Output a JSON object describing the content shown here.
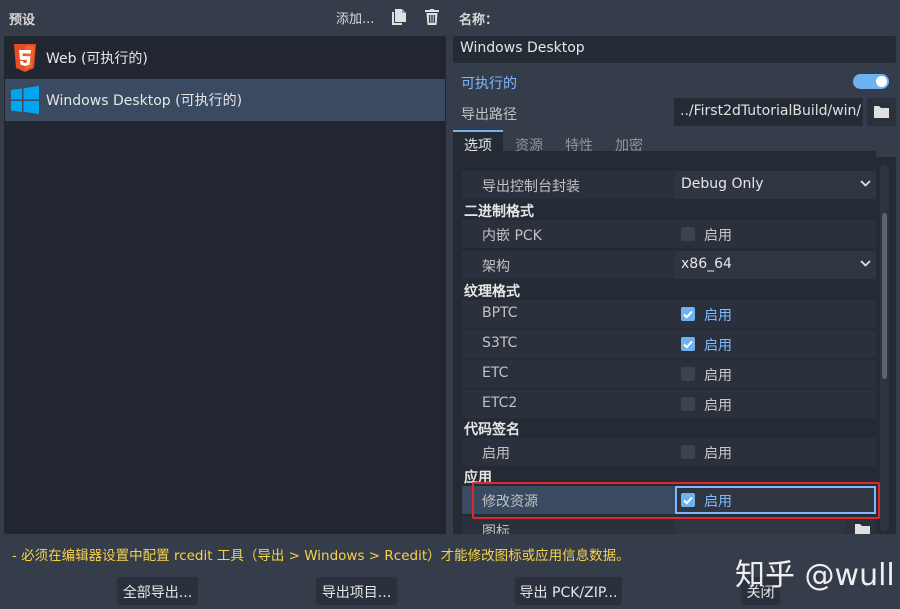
{
  "left": {
    "presets_label": "预设",
    "add_label": "添加...",
    "presets": [
      {
        "label": "Web (可执行的)",
        "icon": "html5-icon",
        "selected": false
      },
      {
        "label": "Windows Desktop (可执行的)",
        "icon": "windows-icon",
        "selected": true
      }
    ]
  },
  "right": {
    "name_label": "名称：",
    "name_value": "Windows Desktop",
    "runnable_label": "可执行的",
    "runnable_on": true,
    "export_path_label": "导出路径",
    "export_path_value": "../First2dTutorialBuild/win/",
    "tabs": [
      "选项",
      "资源",
      "特性",
      "加密"
    ],
    "active_tab": 0,
    "options": {
      "export_console_wrapper_label": "导出控制台封装",
      "export_console_wrapper_value": "Debug Only",
      "binary_format_category": "二进制格式",
      "embed_pck_label": "内嵌 PCK",
      "embed_pck_value": "启用",
      "arch_label": "架构",
      "arch_value": "x86_64",
      "texture_format_category": "纹理格式",
      "bptc_label": "BPTC",
      "bptc_value": "启用",
      "s3tc_label": "S3TC",
      "s3tc_value": "启用",
      "etc_label": "ETC",
      "etc_value": "启用",
      "etc2_label": "ETC2",
      "etc2_value": "启用",
      "codesign_category": "代码签名",
      "codesign_enable_label": "启用",
      "codesign_enable_value": "启用",
      "application_category": "应用",
      "modify_resources_label": "修改资源",
      "modify_resources_value": "启用",
      "icon_label": "图标"
    }
  },
  "warning": "- 必须在编辑器设置中配置 rcedit 工具（导出 > Windows > Rcedit）才能修改图标或应用信息数据。",
  "buttons": {
    "export_all": "全部导出...",
    "export_project": "导出项目...",
    "export_pck_zip": "导出 PCK/ZIP...",
    "close": "关闭"
  },
  "watermark": "知乎 @wull",
  "colors": {
    "accent": "#6eb3ef",
    "warning": "#f5d24a",
    "highlight_box": "#e0292f",
    "html5": "#e44d26",
    "windows": "#00a4ef"
  }
}
